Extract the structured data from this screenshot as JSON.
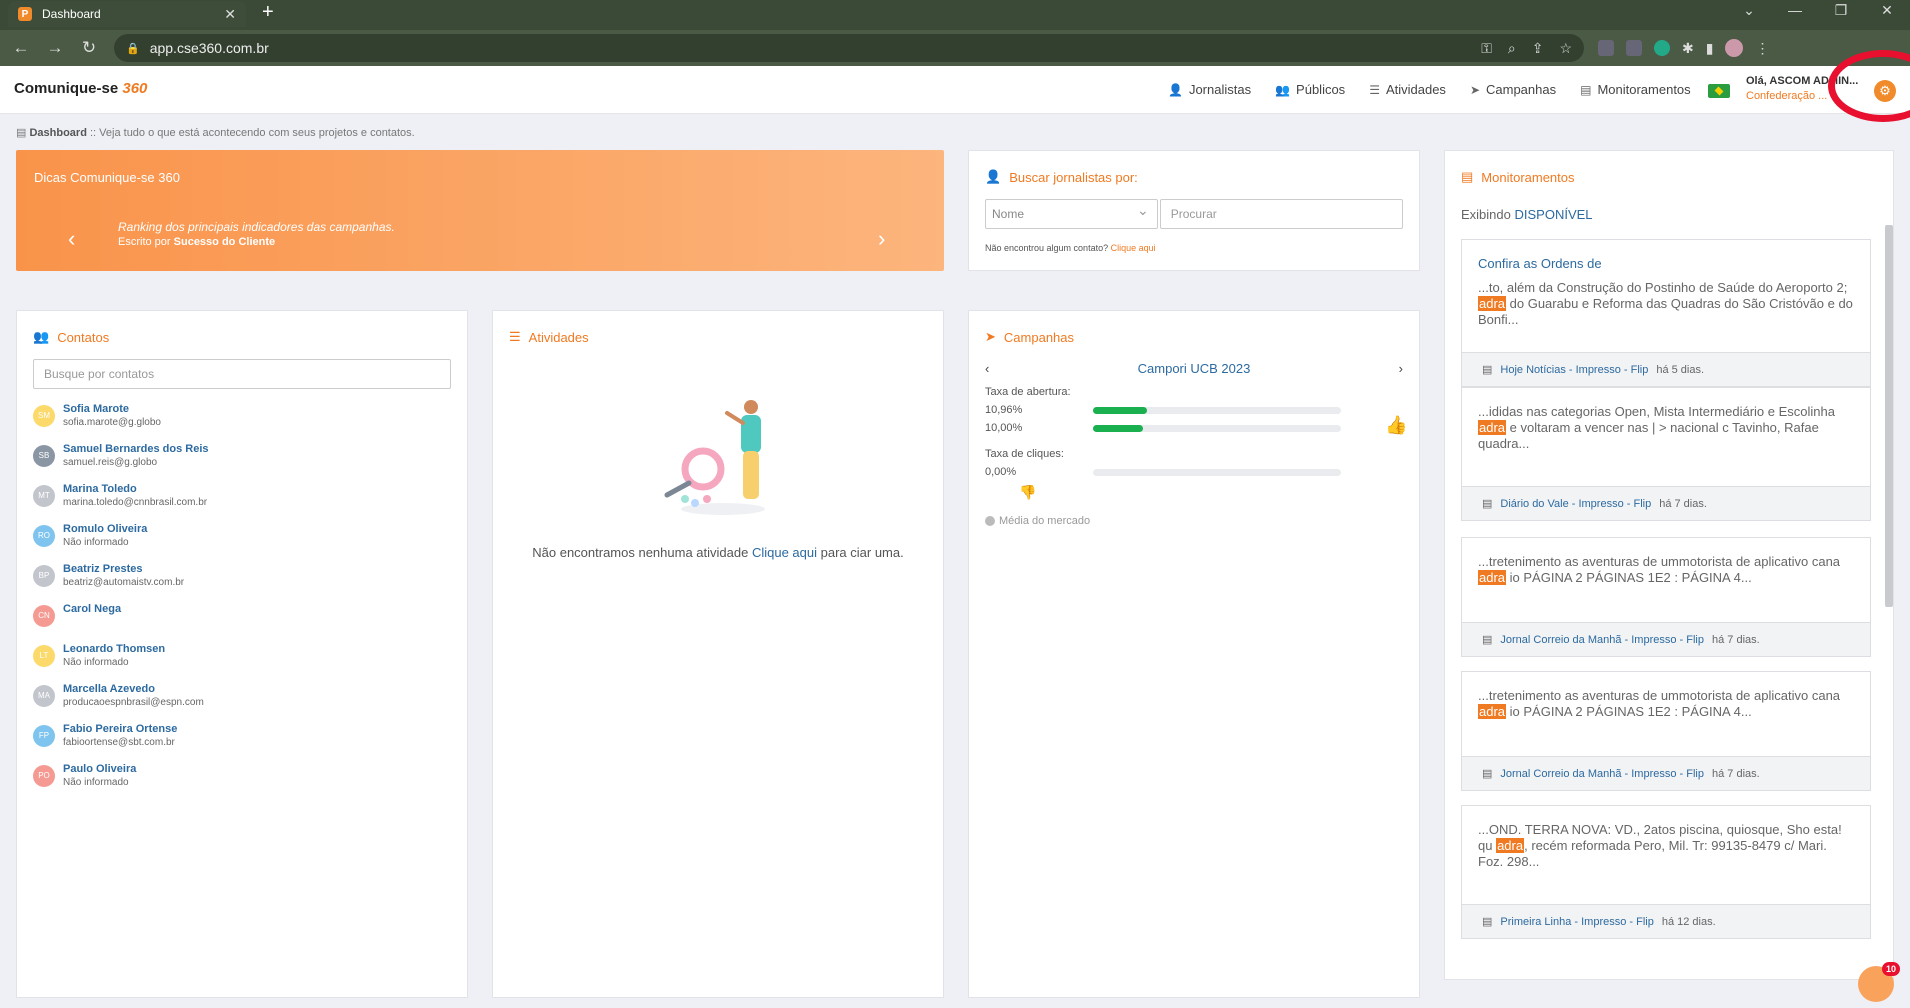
{
  "browser": {
    "tab_title": "Dashboard",
    "url": "app.cse360.com.br"
  },
  "header": {
    "logo_text": "Comunique-se",
    "logo_suffix": "360",
    "menu": [
      "Jornalistas",
      "Públicos",
      "Atividades",
      "Campanhas",
      "Monitoramentos"
    ],
    "greeting": "Olá, ASCOM ADMIN...",
    "organization": "Confederação ..."
  },
  "breadcrumb": {
    "page": "Dashboard",
    "description": ":: Veja tudo o que está acontecendo com seus projetos e contatos."
  },
  "tips": {
    "title": "Dicas Comunique-se 360",
    "text": "Ranking dos principais indicadores das campanhas.",
    "author_prefix": "Escrito por",
    "author": "Sucesso do Cliente"
  },
  "search": {
    "title": "Buscar jornalistas por:",
    "select_value": "Nome",
    "input_placeholder": "Procurar",
    "not_found": "Não encontrou algum contato?",
    "not_found_link": "Clique aqui"
  },
  "contacts": {
    "title": "Contatos",
    "placeholder": "Busque por contatos",
    "items": [
      {
        "initials": "SM",
        "name": "Sofia Marote",
        "sub": "sofia.marote@g.globo",
        "color": "#fbd96b"
      },
      {
        "initials": "SB",
        "name": "Samuel Bernardes dos Reis",
        "sub": "samuel.reis@g.globo",
        "color": "#8b96a4"
      },
      {
        "initials": "MT",
        "name": "Marina Toledo",
        "sub": "marina.toledo@cnnbrasil.com.br",
        "color": "#c2c6cc"
      },
      {
        "initials": "RO",
        "name": "Romulo Oliveira",
        "sub": "Não informado",
        "color": "#7ec4ee"
      },
      {
        "initials": "BP",
        "name": "Beatriz Prestes",
        "sub": "beatriz@automaistv.com.br",
        "color": "#c2c6cc"
      },
      {
        "initials": "CN",
        "name": "Carol Nega",
        "sub": "",
        "color": "#f59a92"
      },
      {
        "initials": "LT",
        "name": "Leonardo Thomsen",
        "sub": "Não informado",
        "color": "#fbd96b"
      },
      {
        "initials": "MA",
        "name": "Marcella Azevedo",
        "sub": "producaoespnbrasil@espn.com",
        "color": "#c2c6cc"
      },
      {
        "initials": "FP",
        "name": "Fabio Pereira Ortense",
        "sub": "fabioortense@sbt.com.br",
        "color": "#7ec4ee"
      },
      {
        "initials": "PO",
        "name": "Paulo Oliveira",
        "sub": "Não informado",
        "color": "#f59a92"
      }
    ]
  },
  "activities": {
    "title": "Atividades",
    "empty_prefix": "Não encontramos nenhuma atividade",
    "empty_link": "Clique aqui",
    "empty_suffix": "para ciar uma."
  },
  "campaigns": {
    "title": "Campanhas",
    "current": "Campori UCB 2023",
    "open_rate_label": "Taxa de abertura:",
    "open_rate_values": [
      {
        "label": "10,96%",
        "fill": 0.1096
      },
      {
        "label": "10,00%",
        "fill": 0.1
      }
    ],
    "click_rate_label": "Taxa de cliques:",
    "click_rate_values": [
      {
        "label": "0,00%",
        "fill": 0
      }
    ],
    "market_label": "Média do mercado"
  },
  "monitoring": {
    "title": "Monitoramentos",
    "showing_label": "Exibindo",
    "showing_value": "DISPONÍVEL",
    "items": [
      {
        "title": "Confira as Ordens de",
        "before": "...to, além da Construção do Postinho de Saúde do Aeroporto 2; ",
        "hl": "adra",
        "after": " do Guarabu e Reforma das Quadras do São Cristóvão e do Bonfi...",
        "source": "Hoje Notícias - Impresso - Flip",
        "when": "há 5 dias."
      },
      {
        "title": "",
        "before": "...ididas nas categorias Open, Mista Intermediário e Escolinha ",
        "hl": "adra",
        "after": " e voltaram a vencer nas | > nacional c Tavinho, Rafae quadra...",
        "source": "Diário do Vale - Impresso - Flip",
        "when": "há 7 dias."
      },
      {
        "title": "",
        "before": "...tretenimento as aventuras de ummotorista de aplicativo cana ",
        "hl": "adra",
        "after": " io PÁGINA 2 PÁGINAS 1E2 : PÁGINA 4...",
        "source": "Jornal Correio da Manhã - Impresso - Flip",
        "when": "há 7 dias."
      },
      {
        "title": "",
        "before": "...tretenimento as aventuras de ummotorista de aplicativo cana ",
        "hl": "adra",
        "after": " io PÁGINA 2 PÁGINAS 1E2 : PÁGINA 4...",
        "source": "Jornal Correio da Manhã - Impresso - Flip",
        "when": "há 7 dias."
      },
      {
        "title": "",
        "before": "...OND. TERRA NOVA: VD., 2atos piscina, quiosque, Sho esta! qu ",
        "hl": "adra",
        "after": ", recém reformada Pero, Mil. Tr: 99135-8479 c/ Mari. Foz. 298...",
        "source": "Primeira Linha - Impresso - Flip",
        "when": "há 12 dias."
      }
    ]
  },
  "chat": {
    "badge": "10"
  },
  "colors": {
    "accent": "#f07a22",
    "link": "#2c6aa0",
    "success": "#1ab04f",
    "alert": "#e8102e"
  }
}
